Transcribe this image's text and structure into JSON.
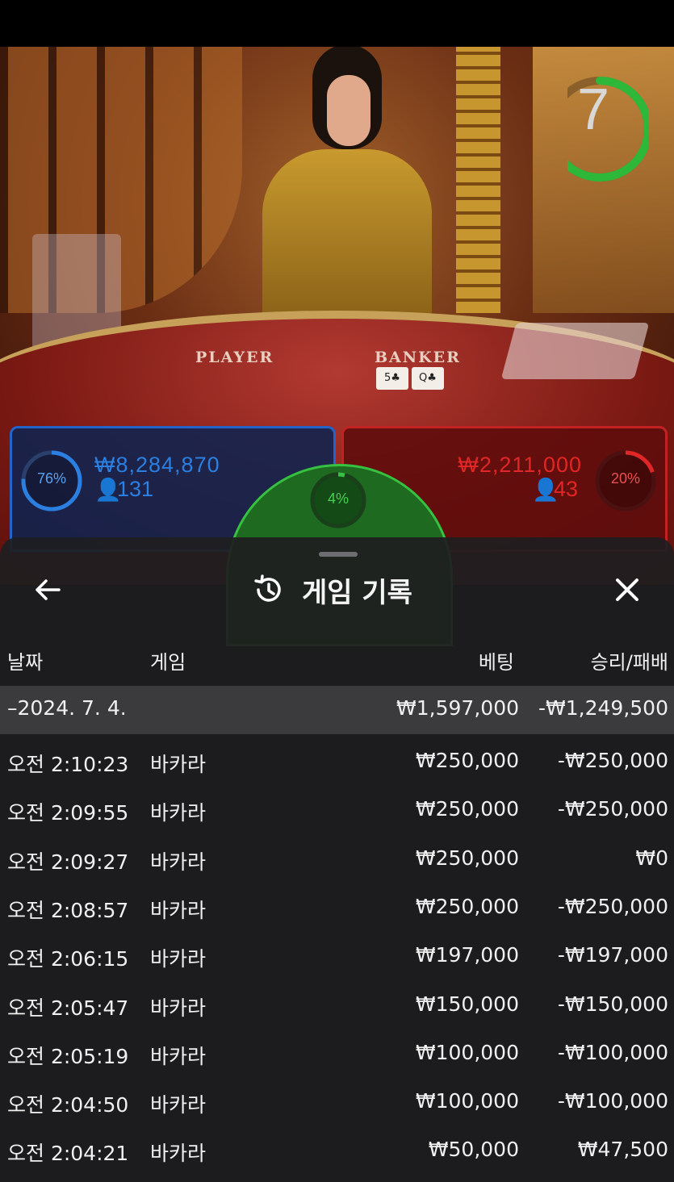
{
  "game_view": {
    "table_labels": {
      "player": "PLAYER",
      "banker": "BANKER"
    },
    "cards": [
      "5♣",
      "Q♣"
    ],
    "timer": {
      "value": "7",
      "progress": 0.7,
      "color": "#2db83a"
    }
  },
  "bets": {
    "player": {
      "percent": "76%",
      "amount": "₩8,284,870",
      "players": "131",
      "color": "#2b7fe0"
    },
    "tie": {
      "percent": "4%",
      "color": "#35c43f"
    },
    "banker": {
      "percent": "20%",
      "amount": "₩2,211,000",
      "players": "43",
      "color": "#e02626"
    }
  },
  "history": {
    "title": "게임 기록",
    "icons": {
      "back": "arrow-left-icon",
      "history": "history-icon",
      "close": "close-icon"
    },
    "columns": {
      "date": "날짜",
      "game": "게임",
      "bet": "베팅",
      "result": "승리/패배"
    },
    "date_group": {
      "label": "–2024. 7. 4.",
      "bet": "₩1,597,000",
      "result": "-₩1,249,500"
    },
    "rows": [
      {
        "time": "오전 2:10:23",
        "game": "바카라",
        "bet": "₩250,000",
        "result": "-₩250,000"
      },
      {
        "time": "오전 2:09:55",
        "game": "바카라",
        "bet": "₩250,000",
        "result": "-₩250,000"
      },
      {
        "time": "오전 2:09:27",
        "game": "바카라",
        "bet": "₩250,000",
        "result": "₩0"
      },
      {
        "time": "오전 2:08:57",
        "game": "바카라",
        "bet": "₩250,000",
        "result": "-₩250,000"
      },
      {
        "time": "오전 2:06:15",
        "game": "바카라",
        "bet": "₩197,000",
        "result": "-₩197,000"
      },
      {
        "time": "오전 2:05:47",
        "game": "바카라",
        "bet": "₩150,000",
        "result": "-₩150,000"
      },
      {
        "time": "오전 2:05:19",
        "game": "바카라",
        "bet": "₩100,000",
        "result": "-₩100,000"
      },
      {
        "time": "오전 2:04:50",
        "game": "바카라",
        "bet": "₩100,000",
        "result": "-₩100,000"
      },
      {
        "time": "오전 2:04:21",
        "game": "바카라",
        "bet": "₩50,000",
        "result": "₩47,500"
      }
    ]
  }
}
